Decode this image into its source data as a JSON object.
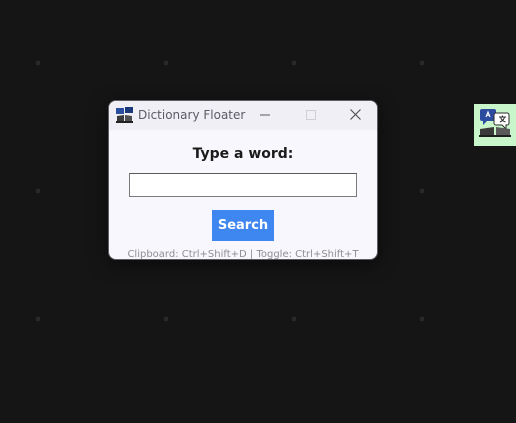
{
  "window": {
    "title": "Dictionary Floater",
    "icon": "dictionary-app-icon",
    "controls": [
      "minimize-icon",
      "maximize-icon",
      "close-icon"
    ]
  },
  "content": {
    "prompt": "Type a word:",
    "input_value": "",
    "search_label": "Search",
    "hint": "Clipboard: Ctrl+Shift+D | Toggle: Ctrl+Shift+T"
  },
  "tray": {
    "icon": "translate-dictionary-icon"
  },
  "colors": {
    "desktop_background": "#151515",
    "window_background": "#f8f7fd",
    "search_button": "#3f87f0",
    "tray_background": "#c9f5cb"
  }
}
